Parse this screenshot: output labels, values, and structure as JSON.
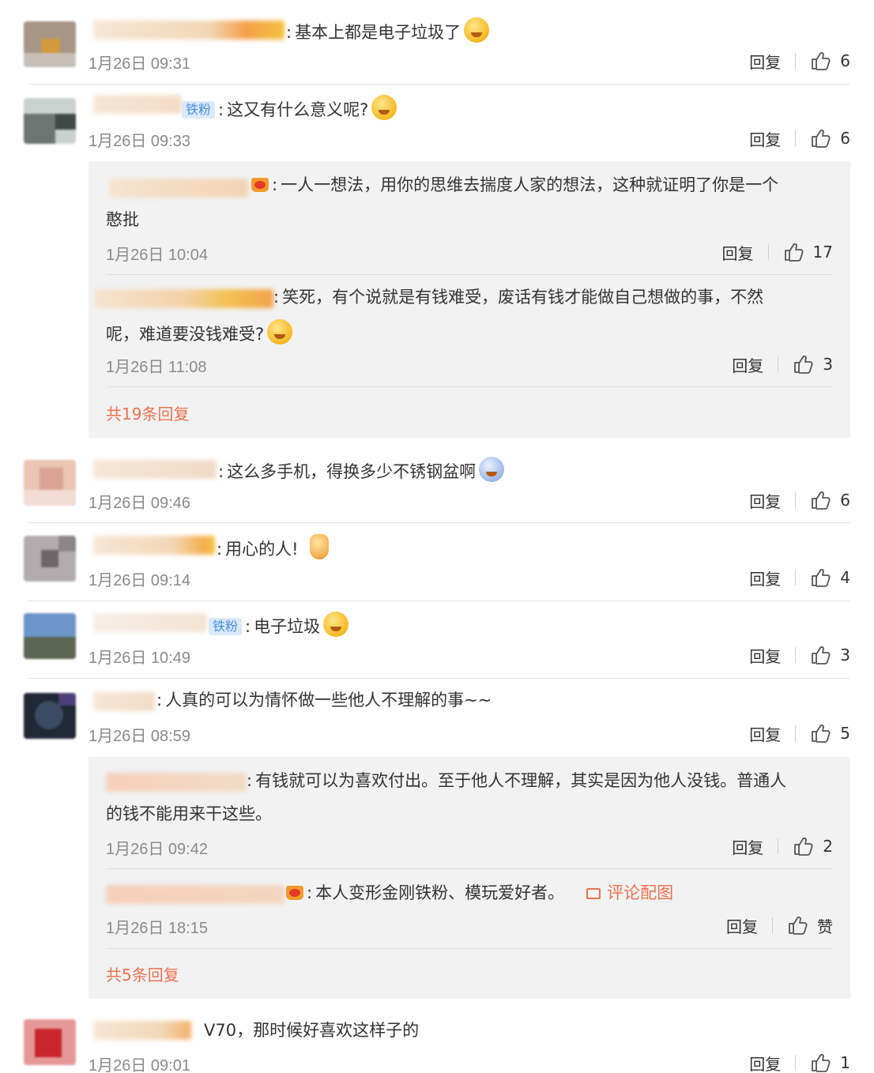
{
  "comments": [
    {
      "text": "基本上都是电子垃圾了",
      "time": "1月26日 09:31",
      "reply_label": "回复",
      "likes": "6"
    },
    {
      "badge": "铁粉",
      "text": "这又有什么意义呢?",
      "time": "1月26日 09:33",
      "reply_label": "回复",
      "likes": "6",
      "replies": [
        {
          "text_l1": "一人一想法，用你的思维去揣度人家的想法，这种就证明了你是一个",
          "text_l2": "憨批",
          "time": "1月26日 10:04",
          "reply_label": "回复",
          "likes": "17"
        },
        {
          "text_l1": "笑死，有个说就是有钱难受，废话有钱才能做自己想做的事，不然",
          "text_l2": "呢，难道要没钱难受?",
          "time": "1月26日 11:08",
          "reply_label": "回复",
          "likes": "3"
        }
      ],
      "more": "共19条回复"
    },
    {
      "text": "这么多手机，得换多少不锈钢盆啊",
      "time": "1月26日 09:46",
      "reply_label": "回复",
      "likes": "6"
    },
    {
      "text": "用心的人!",
      "time": "1月26日 09:14",
      "reply_label": "回复",
      "likes": "4"
    },
    {
      "badge": "铁粉",
      "text": "电子垃圾",
      "time": "1月26日 10:49",
      "reply_label": "回复",
      "likes": "3"
    },
    {
      "text": "人真的可以为情怀做一些他人不理解的事~~",
      "time": "1月26日 08:59",
      "reply_label": "回复",
      "likes": "5",
      "replies": [
        {
          "text_l1": "有钱就可以为喜欢付出。至于他人不理解，其实是因为他人没钱。普通人",
          "text_l2": "的钱不能用来干这些。",
          "time": "1月26日 09:42",
          "reply_label": "回复",
          "likes": "2"
        },
        {
          "text_l1": "本人变形金刚铁粉、模玩爱好者。",
          "pic_link": "评论配图",
          "time": "1月26日 18:15",
          "reply_label": "回复",
          "likes": "赞"
        }
      ],
      "more": "共5条回复"
    },
    {
      "text": "V70，那时候好喜欢这样子的",
      "time": "1月26日 09:01",
      "reply_label": "回复",
      "likes": "1"
    }
  ],
  "colors": {
    "link": "#eb7350",
    "badge_bg": "#dbe9fb",
    "badge_text": "#4a8fe0",
    "time": "#8a8a8a"
  },
  "icons": {
    "like": "thumbs-up-icon",
    "picture": "image-icon"
  }
}
